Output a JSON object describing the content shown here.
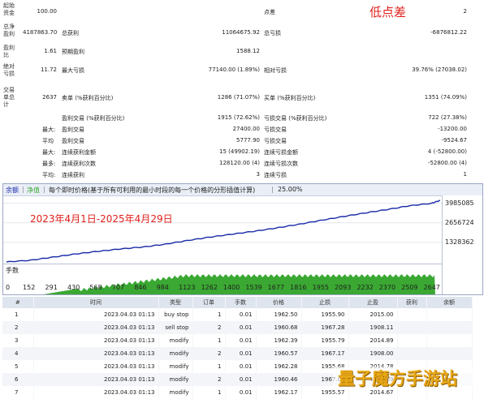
{
  "stats": {
    "col1": [
      {
        "label": "起始\n资金",
        "value": "100.00"
      },
      {
        "label": "总净\n盈利",
        "value": "4187863.70"
      },
      {
        "label": "盈利\n比",
        "value": "1.61"
      },
      {
        "label": "绝对\n亏损",
        "value": "11.72"
      },
      {
        "label": "交易\n单总\n计",
        "value": "2637"
      }
    ],
    "col2": [
      {
        "label": "总获利",
        "value": "11064675.92"
      },
      {
        "label": "预期盈利",
        "value": "1588.12"
      },
      {
        "label": "最大亏损",
        "value": "77140.00 (1.89%)"
      },
      {
        "label": "卖单 (%获利百分比)",
        "value": "1286 (71.07%)"
      },
      {
        "label": "盈利交易 (%获利百分比)",
        "value": "1915 (72.62%)"
      },
      {
        "label": "盈利交易",
        "value": "27400.00",
        "prefix": "最大:"
      },
      {
        "label": "盈利交易",
        "value": "5777.90",
        "prefix": "平均"
      },
      {
        "label": "连续获利金额",
        "value": "15 (49902.19)",
        "prefix": "最大:"
      },
      {
        "label": "连续获利次数",
        "value": "128120.00 (4)",
        "prefix": "最多:"
      },
      {
        "label": "连续获利",
        "value": "3",
        "prefix": "平均:"
      }
    ],
    "col3": [
      {
        "label": "点差",
        "value": "2"
      },
      {
        "label": "总亏损",
        "value": "-6876812.22"
      },
      {
        "label": "",
        "value": ""
      },
      {
        "label": "相对亏损",
        "value": "39.76% (27038.02)"
      },
      {
        "label": "买单 (%获利百分比)",
        "value": "1351 (74.09%)"
      },
      {
        "label": "亏损交易 (%获利百分比)",
        "value": "722 (27.38%)"
      },
      {
        "label": "亏损交易",
        "value": "-13200.00"
      },
      {
        "label": "亏损交易",
        "value": "-9524.67"
      },
      {
        "label": "连续亏损金额",
        "value": "4 (-52800.00)"
      },
      {
        "label": "连续亏损次数",
        "value": "-52800.00 (4)"
      },
      {
        "label": "连续亏损",
        "value": "1"
      }
    ],
    "annotation": "低点差"
  },
  "chart": {
    "legend_balance": "余额",
    "legend_equity": "净值",
    "header_text": "每个即时价格(基于所有可利用的最小时段的每一个价格的分形插值计算)",
    "quality": "25.00%",
    "date_range": "2023年4月1日-2025年4月29日",
    "volume_label": "手数",
    "colors": {
      "balance": "#1a2aa8",
      "volume": "#3aa832",
      "annotation": "#e0201b"
    }
  },
  "chart_data": {
    "type": "line",
    "title": "每个即时价格(基于所有可利用的最小时段的每一个价格的分形插值计算)",
    "xlabel": "",
    "ylabel": "",
    "x_ticks": [
      "0",
      "152",
      "291",
      "430",
      "568",
      "707",
      "846",
      "984",
      "1123",
      "1262",
      "1400",
      "1539",
      "1677",
      "1816",
      "1955",
      "2093",
      "2232",
      "2370",
      "2509",
      "2647"
    ],
    "y_ticks": [
      "3985085",
      "2656724",
      "1328362"
    ],
    "ylim": [
      0,
      4187964
    ],
    "xlim": [
      0,
      2700
    ],
    "series": [
      {
        "name": "余额",
        "x": [
          0,
          152,
          291,
          430,
          568,
          707,
          846,
          984,
          1123,
          1262,
          1400,
          1539,
          1677,
          1816,
          1955,
          2093,
          2232,
          2370,
          2509,
          2647,
          2700
        ],
        "values": [
          100,
          120000,
          330000,
          540000,
          720000,
          880000,
          1010000,
          1200000,
          1450000,
          1680000,
          1880000,
          2080000,
          2300000,
          2550000,
          2820000,
          3080000,
          3330000,
          3560000,
          3820000,
          3985085,
          4187964
        ]
      }
    ]
  },
  "orders": {
    "headers": [
      "#",
      "时间",
      "类型",
      "订单",
      "手数",
      "价格",
      "止损",
      "止盈",
      "获利",
      "余额"
    ],
    "rows": [
      [
        "1",
        "2023.04.03 01:13",
        "buy stop",
        "1",
        "0.01",
        "1962.50",
        "1955.90",
        "2015.00",
        "",
        ""
      ],
      [
        "2",
        "2023.04.03 01:13",
        "sell stop",
        "2",
        "0.01",
        "1960.68",
        "1967.28",
        "1908.11",
        "",
        ""
      ],
      [
        "3",
        "2023.04.03 01:13",
        "modify",
        "1",
        "0.01",
        "1962.39",
        "1955.79",
        "2014.89",
        "",
        ""
      ],
      [
        "4",
        "2023.04.03 01:13",
        "modify",
        "2",
        "0.01",
        "1960.57",
        "1967.17",
        "1908.00",
        "",
        ""
      ],
      [
        "5",
        "2023.04.03 01:13",
        "modify",
        "1",
        "0.01",
        "1962.28",
        "1955.68",
        "2014.78",
        "",
        ""
      ],
      [
        "6",
        "2023.04.03 01:13",
        "modify",
        "2",
        "0.01",
        "1960.46",
        "1967.06",
        "1907.89",
        "",
        ""
      ],
      [
        "7",
        "2023.04.03 01:13",
        "modify",
        "1",
        "0.01",
        "1962.17",
        "1955.57",
        "2014.67",
        "",
        ""
      ]
    ]
  },
  "watermark": "量子魔方手游站"
}
